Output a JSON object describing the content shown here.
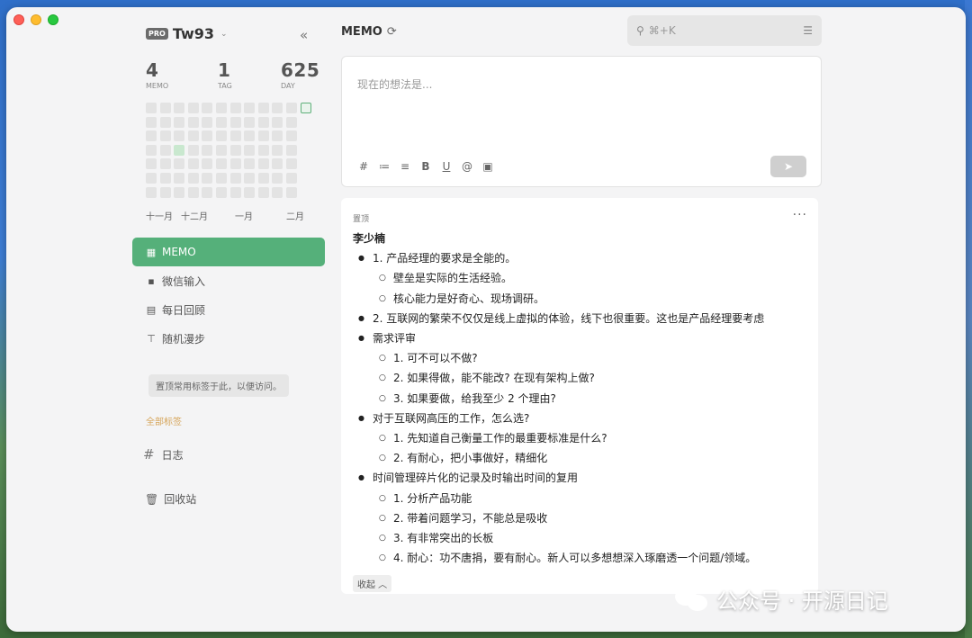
{
  "sidebar": {
    "pro_badge": "PRO",
    "username": "Tw93",
    "stats": [
      {
        "num": "4",
        "label": "MEMO"
      },
      {
        "num": "1",
        "label": "TAG"
      },
      {
        "num": "625",
        "label": "DAY"
      }
    ],
    "months": [
      "十一月",
      "十二月",
      "一月",
      "二月"
    ],
    "nav": [
      {
        "icon": "grid-icon",
        "label": "MEMO",
        "active": true
      },
      {
        "icon": "chat-icon",
        "label": "微信输入"
      },
      {
        "icon": "calendar-icon",
        "label": "每日回顾"
      },
      {
        "icon": "signpost-icon",
        "label": "随机漫步"
      }
    ],
    "pin_hint": "置顶常用标签于此，以便访问。",
    "all_tags": "全部标签",
    "tag": "日志",
    "trash": "回收站"
  },
  "main": {
    "title": "MEMO",
    "search_placeholder": "⌘+K",
    "editor_placeholder": "现在的想法是...",
    "toolbar": [
      "#",
      "≔",
      "≡",
      "B",
      "U",
      "@",
      "▣"
    ],
    "memo": {
      "pin_label": "置顶",
      "author": "李少楠",
      "items": [
        {
          "level": 1,
          "text": "1. 产品经理的要求是全能的。"
        },
        {
          "level": 2,
          "text": "壁垒是实际的生活经验。"
        },
        {
          "level": 2,
          "text": "核心能力是好奇心、现场调研。"
        },
        {
          "level": 1,
          "text": "2. 互联网的繁荣不仅仅是线上虚拟的体验，线下也很重要。这也是产品经理要考虑"
        },
        {
          "level": 1,
          "text": "需求评审"
        },
        {
          "level": 2,
          "text": "1. 可不可以不做?"
        },
        {
          "level": 2,
          "text": "2. 如果得做，能不能改? 在现有架构上做?"
        },
        {
          "level": 2,
          "text": "3. 如果要做，给我至少 2 个理由?"
        },
        {
          "level": 1,
          "text": "对于互联网高压的工作，怎么选?"
        },
        {
          "level": 2,
          "text": "1. 先知道自己衡量工作的最重要标准是什么?"
        },
        {
          "level": 2,
          "text": "2. 有耐心，把小事做好，精细化"
        },
        {
          "level": 1,
          "text": "时间管理碎片化的记录及时输出时间的复用"
        },
        {
          "level": 2,
          "text": "1. 分析产品功能"
        },
        {
          "level": 2,
          "text": "2. 带着问题学习，不能总是吸收"
        },
        {
          "level": 2,
          "text": "3. 有非常突出的长板"
        },
        {
          "level": 2,
          "text": "4. 耐心：功不唐捐，要有耐心。新人可以多想想深入琢磨透一个问题/领域。"
        }
      ],
      "fold_label": "收起 ︿"
    }
  },
  "watermark": "公众号 · 开源日记",
  "colors": {
    "accent": "#55b07a",
    "heat_active": "#c9e8cf",
    "tag_gold": "#d6a55a"
  }
}
